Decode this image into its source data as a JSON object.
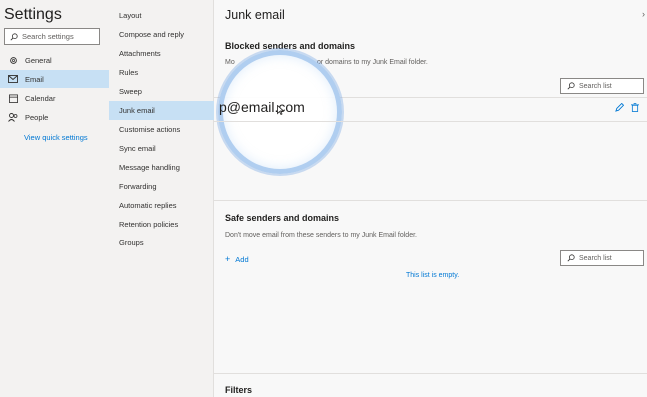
{
  "settings": {
    "title": "Settings",
    "search_placeholder": "Search settings"
  },
  "nav": {
    "items": [
      {
        "label": "General",
        "icon": "gear-icon"
      },
      {
        "label": "Email",
        "icon": "mail-icon"
      },
      {
        "label": "Calendar",
        "icon": "calendar-icon"
      },
      {
        "label": "People",
        "icon": "people-icon"
      }
    ],
    "selected": "Email",
    "quick_settings_link": "View quick settings"
  },
  "subnav": {
    "items": [
      "Layout",
      "Compose and reply",
      "Attachments",
      "Rules",
      "Sweep",
      "Junk email",
      "Customise actions",
      "Sync email",
      "Message handling",
      "Forwarding",
      "Automatic replies",
      "Retention policies",
      "Groups"
    ],
    "selected": "Junk email"
  },
  "main": {
    "title": "Junk email",
    "blocked": {
      "title": "Blocked senders and domains",
      "desc_left": "Mo",
      "desc_right": "or domains to my Junk Email folder.",
      "search_label": "Search list",
      "entry": "p@email.com"
    },
    "safe": {
      "title": "Safe senders and domains",
      "desc": "Don't move email from these senders to my Junk Email folder.",
      "add_label": "Add",
      "search_label": "Search list",
      "empty_text": "This list is empty."
    },
    "filters_title": "Filters"
  },
  "colors": {
    "accent": "#0078d4",
    "selected_bg": "#c7e0f4"
  }
}
